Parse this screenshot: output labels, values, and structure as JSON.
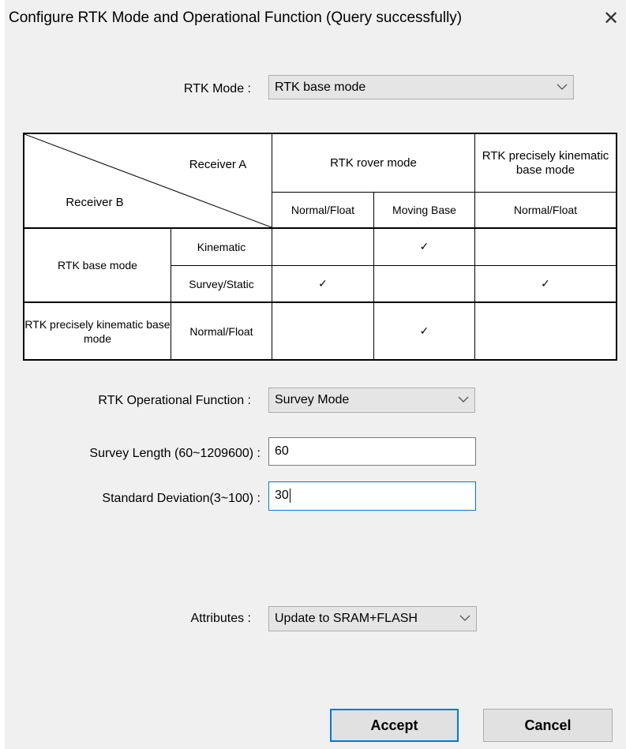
{
  "window": {
    "title": "Configure RTK Mode and Operational Function (Query successfully)",
    "close_glyph": "✕"
  },
  "rtk_mode": {
    "label": "RTK Mode :",
    "value": "RTK base mode"
  },
  "matrix": {
    "receiver_a": "Receiver A",
    "receiver_b": "Receiver B",
    "col_groups": [
      "RTK rover mode",
      "RTK precisely kinematic base mode"
    ],
    "col_subs": [
      "Normal/Float",
      "Moving Base",
      "Normal/Float"
    ],
    "row_groups": [
      "RTK base mode",
      "RTK precisely kinematic base mode"
    ],
    "row_subs": [
      "Kinematic",
      "Survey/Static",
      "Normal/Float"
    ],
    "check_glyph": "✓",
    "checks": [
      [
        false,
        true,
        false
      ],
      [
        true,
        false,
        true
      ],
      [
        false,
        true,
        false
      ]
    ]
  },
  "operational_function": {
    "label": "RTK Operational Function :",
    "value": "Survey Mode"
  },
  "survey_length": {
    "label": "Survey Length (60~1209600) :",
    "value": "60"
  },
  "standard_deviation": {
    "label": "Standard Deviation(3~100) :",
    "value": "30"
  },
  "attributes": {
    "label": "Attributes :",
    "value": "Update to SRAM+FLASH"
  },
  "buttons": {
    "accept": "Accept",
    "cancel": "Cancel"
  },
  "colors": {
    "focus_accent": "#0078d7",
    "dialog_bg": "#f0f0f0"
  },
  "icons": {
    "dropdown": "chevron-down-icon",
    "close": "close-icon",
    "check": "check-icon"
  }
}
